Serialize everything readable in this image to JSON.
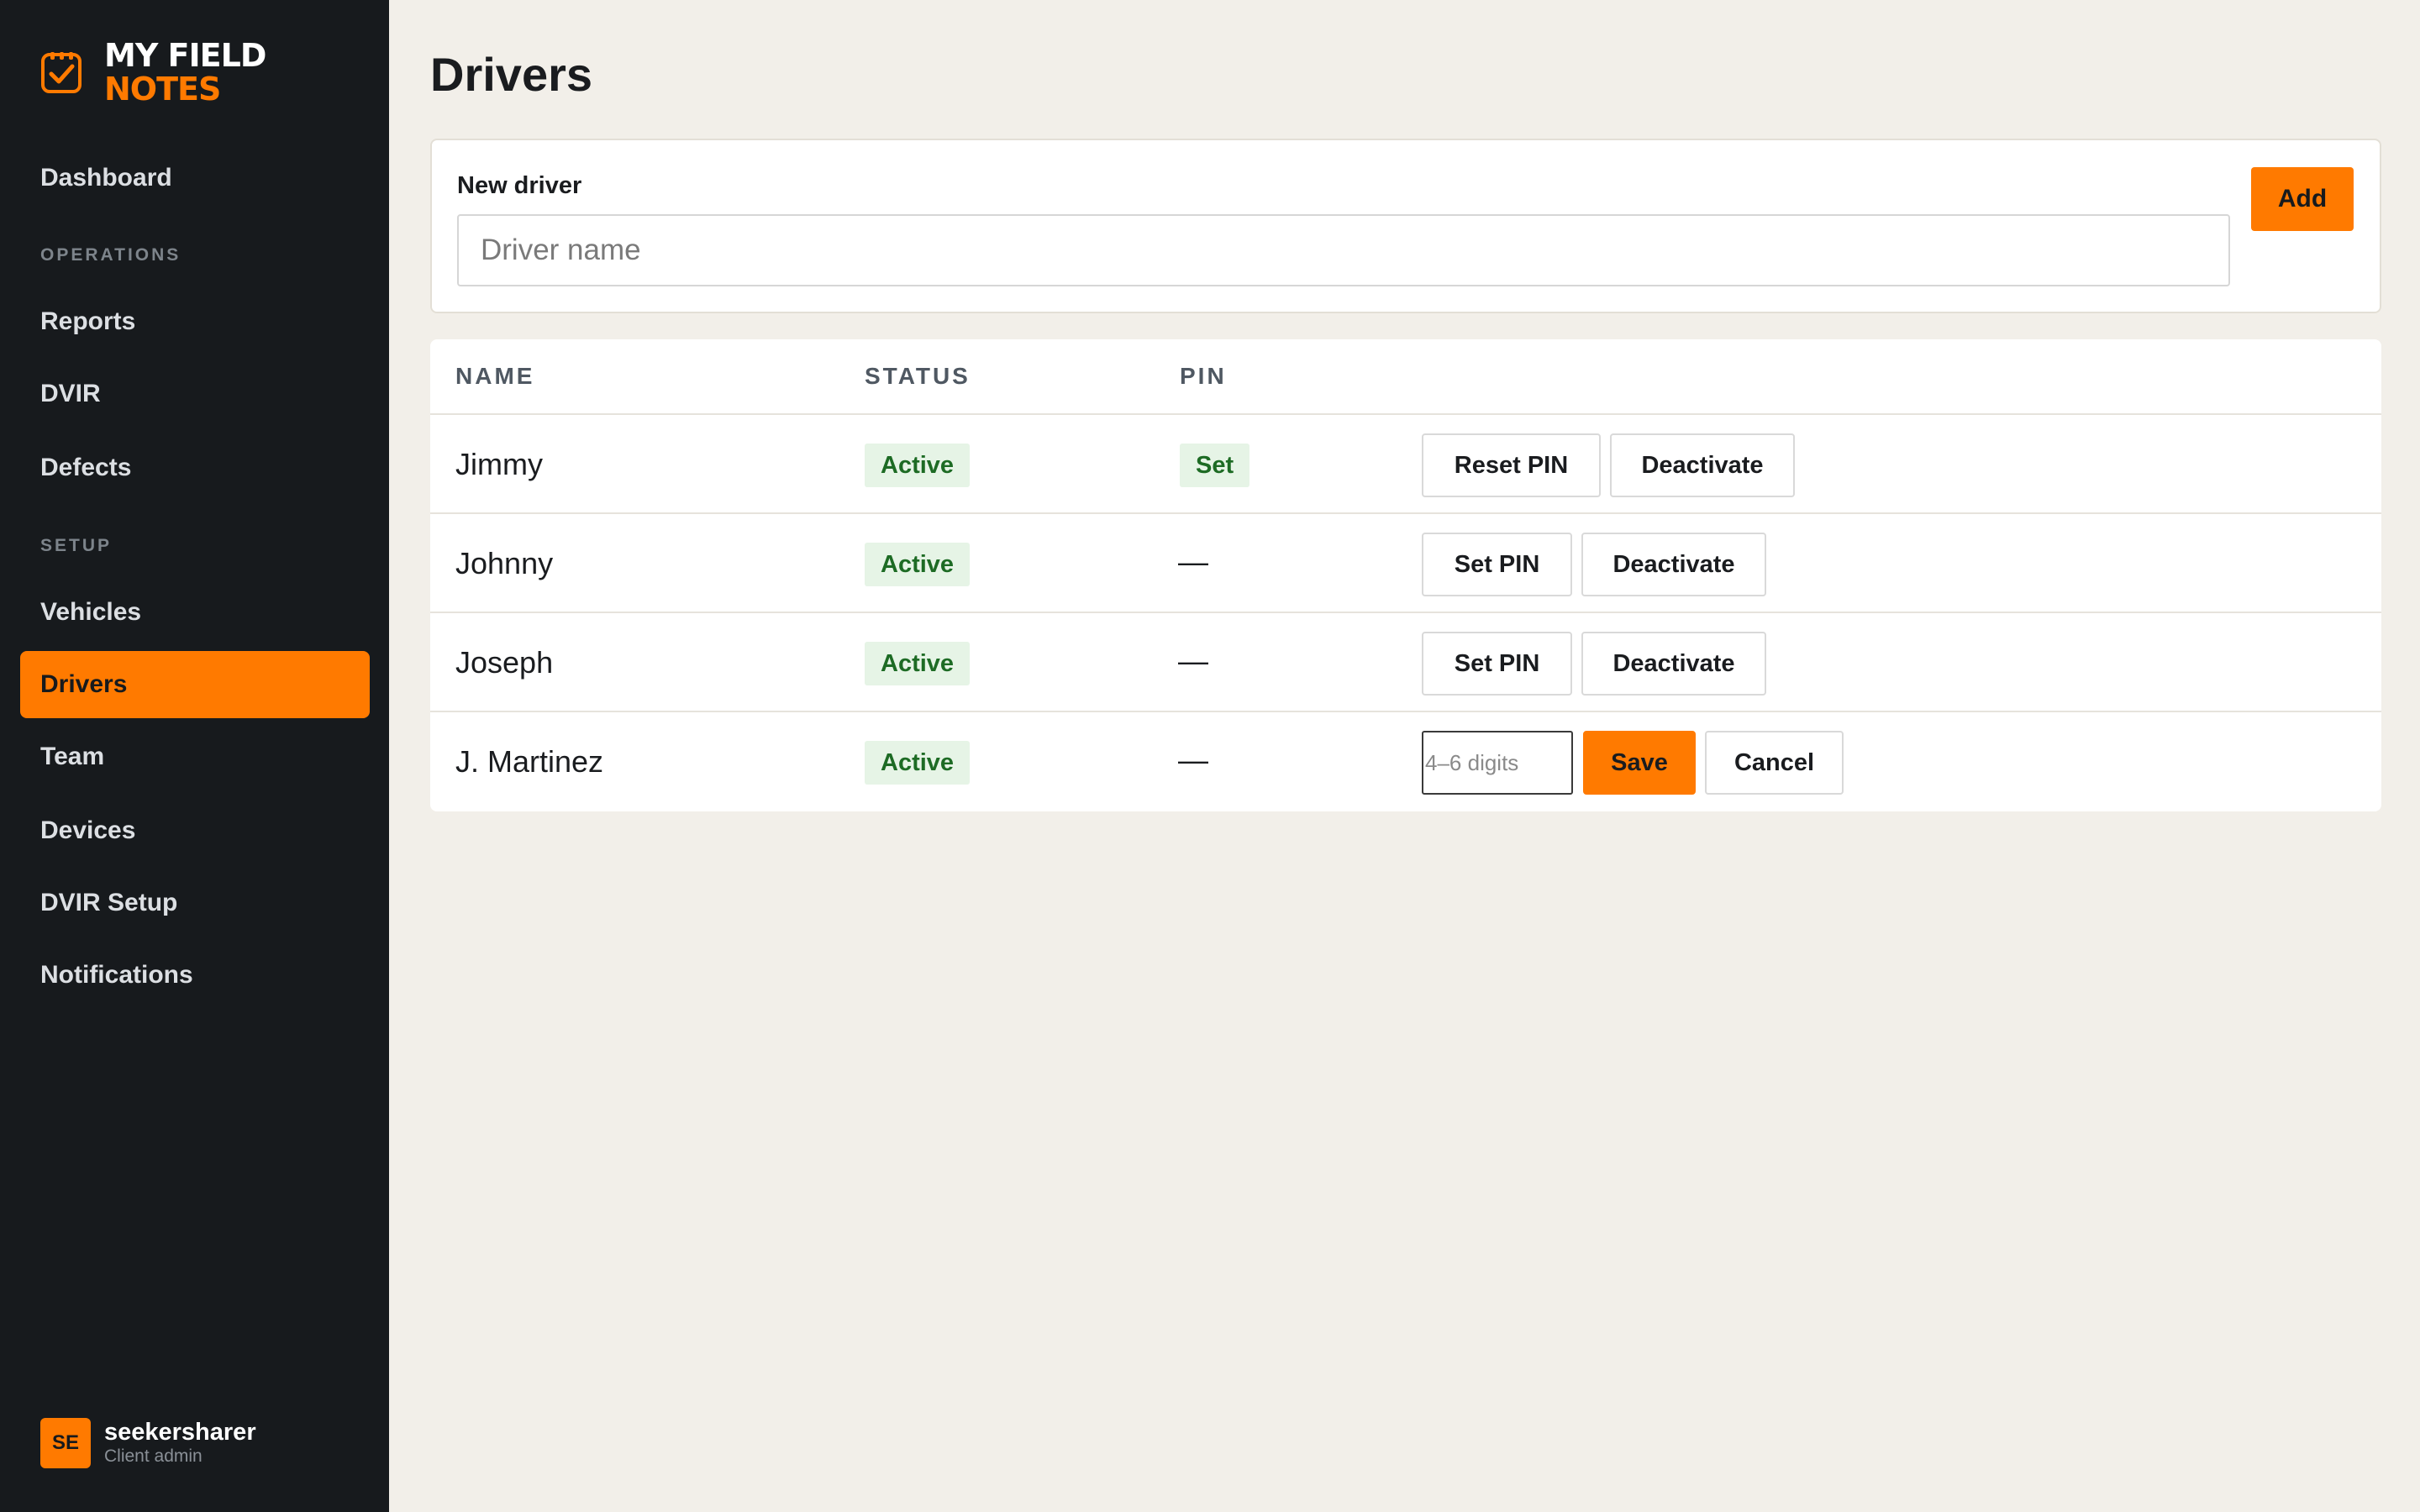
{
  "app": {
    "brand_line1": "MY FIELD",
    "brand_line2": "NOTES",
    "accent_color": "#ff7a00",
    "sidebar_color": "#171a1d"
  },
  "sidebar": {
    "dashboard": "Dashboard",
    "section_operations": "OPERATIONS",
    "operations": [
      "Reports",
      "DVIR",
      "Defects"
    ],
    "section_setup": "SETUP",
    "setup": [
      "Vehicles",
      "Drivers",
      "Team",
      "Devices",
      "DVIR Setup",
      "Notifications"
    ],
    "active_item": "Drivers"
  },
  "user": {
    "initials": "SE",
    "name": "seekersharer",
    "role": "Client admin"
  },
  "page": {
    "title": "Drivers"
  },
  "new_driver": {
    "label": "New driver",
    "placeholder": "Driver name",
    "value": "",
    "add_label": "Add"
  },
  "table": {
    "headers": [
      "NAME",
      "STATUS",
      "PIN"
    ],
    "rows": [
      {
        "name": "Jimmy",
        "status": "Active",
        "pin": "Set",
        "actions": [
          "Reset PIN",
          "Deactivate"
        ]
      },
      {
        "name": "Johnny",
        "status": "Active",
        "pin": "—",
        "actions": [
          "Set PIN",
          "Deactivate"
        ]
      },
      {
        "name": "Joseph",
        "status": "Active",
        "pin": "—",
        "actions": [
          "Set PIN",
          "Deactivate"
        ]
      },
      {
        "name": "J. Martinez",
        "status": "Active",
        "pin": "—",
        "pin_input_placeholder": "4–6 digits",
        "actions": [
          "Save",
          "Cancel"
        ]
      }
    ]
  }
}
